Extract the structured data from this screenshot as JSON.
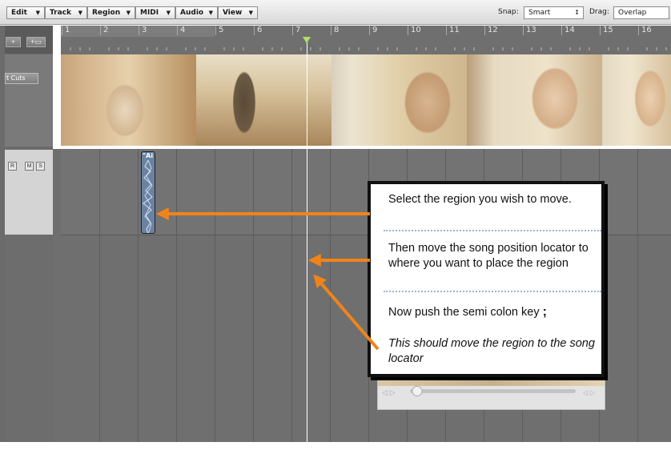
{
  "menubar": {
    "items": [
      "Edit",
      "Track",
      "Region",
      "MIDI",
      "Audio",
      "View"
    ],
    "snap_label": "Snap:",
    "snap_value": "Smart",
    "drag_label": "Drag:",
    "drag_value": "Overlap"
  },
  "left": {
    "add_track_glyph": "+",
    "add_folder_glyph": "+▭",
    "cuts_button": "t Cuts",
    "record": "R",
    "mute": "M",
    "solo": "S"
  },
  "ruler": {
    "bars": [
      "1",
      "2",
      "3",
      "4",
      "5",
      "6",
      "7",
      "8",
      "9",
      "10",
      "11",
      "12",
      "13",
      "14",
      "15",
      "16"
    ]
  },
  "region": {
    "label": "\"Ai"
  },
  "callout": {
    "step1": "Select the region you wish to move.",
    "step2": "Then move the song position locator to where you want to place the region",
    "step3": "Now push the semi colon key",
    "step3_key": ";",
    "step4": "This should move the region to the song locator"
  },
  "colors": {
    "arrow": "#f0841a",
    "region": "#6a83a3",
    "playhead_marker": "#aee06a"
  },
  "icons": {
    "playhead": "triangle-down-icon",
    "arrows": "arrow-left-icon"
  }
}
